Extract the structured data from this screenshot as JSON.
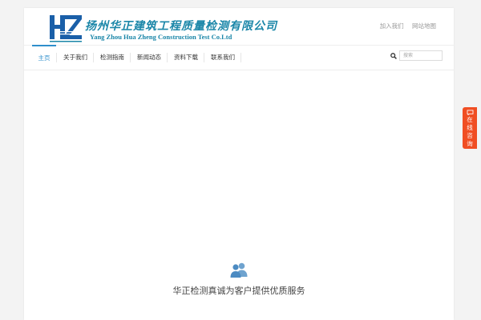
{
  "header": {
    "logo_cn": "扬州华正建筑工程质量检测有限公司",
    "logo_en": "Yang Zhou Hua Zheng Construction Test Co.Ltd",
    "logo_mark": "HZ",
    "top_links": [
      "加入我们",
      "网站地图"
    ]
  },
  "nav": {
    "items": [
      "主页",
      "关于我们",
      "检测指南",
      "新闻动态",
      "资料下载",
      "联系我们"
    ],
    "active_index": 0
  },
  "search": {
    "placeholder": "搜索",
    "icon": "search-icon"
  },
  "feature": {
    "icon": "users-icon",
    "tagline": "华正检测真诚为客户提供优质服务"
  },
  "consult": {
    "chars": [
      "在",
      "线",
      "咨",
      "询"
    ],
    "icon": "chat-icon"
  },
  "colors": {
    "brand": "#1a86a8",
    "accent": "#2f8fcc",
    "consult_bg": "#f04e23"
  }
}
